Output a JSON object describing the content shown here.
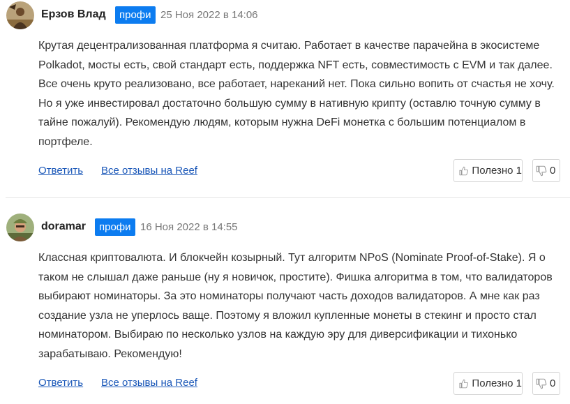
{
  "colors": {
    "badge_bg": "#0c7cf0",
    "link": "#1a57b8"
  },
  "reviews": [
    {
      "author": "Ерзов Влад",
      "badge": "профи",
      "date": "25 Ноя 2022 в 14:06",
      "avatar_icon": "user-photo-avatar",
      "text_lines": [
        "Крутая децентрализованная платформа я считаю. Работает в качестве парачейна в экосистеме",
        "Polkadot, мосты есть, свой стандарт есть, поддержка NFT есть, совместимость с EVM и так далее.",
        "Все очень круто реализовано, все работает, нареканий нет. Пока сильно вопить от счастья не хочу.",
        "Но я уже инвестировал достаточно большую сумму в нативную крипту (оставлю точную сумму в",
        "тайне пожалуй). Рекомендую людям, которым нужна DeFi монетка с большим потенциалом в",
        "портфеле."
      ],
      "reply_label": "Ответить",
      "all_reviews_label": "Все отзывы на Reef",
      "useful_label": "Полезно 1",
      "dislike_count": "0"
    },
    {
      "author": "doramar",
      "badge": "профи",
      "date": "16 Ноя 2022 в 14:55",
      "avatar_icon": "user-photo-avatar",
      "text_lines": [
        "Классная криптовалюта. И блокчейн козырный. Тут алгоритм NPoS (Nominate Proof-of-Stake). Я о",
        "таком не слышал даже раньше (ну я новичок, простите). Фишка алгоритма в том, что валидаторов",
        "выбирают номинаторы. За это номинаторы получают часть доходов валидаторов. А мне как раз",
        "создание узла не уперлось ваще. Поэтому я вложил купленные монеты в стекинг и просто стал",
        "номинатором. Выбираю по несколько узлов на каждую эру для диверсификации и тихонько",
        "зарабатываю. Рекомендую!"
      ],
      "reply_label": "Ответить",
      "all_reviews_label": "Все отзывы на Reef",
      "useful_label": "Полезно 1",
      "dislike_count": "0"
    }
  ]
}
